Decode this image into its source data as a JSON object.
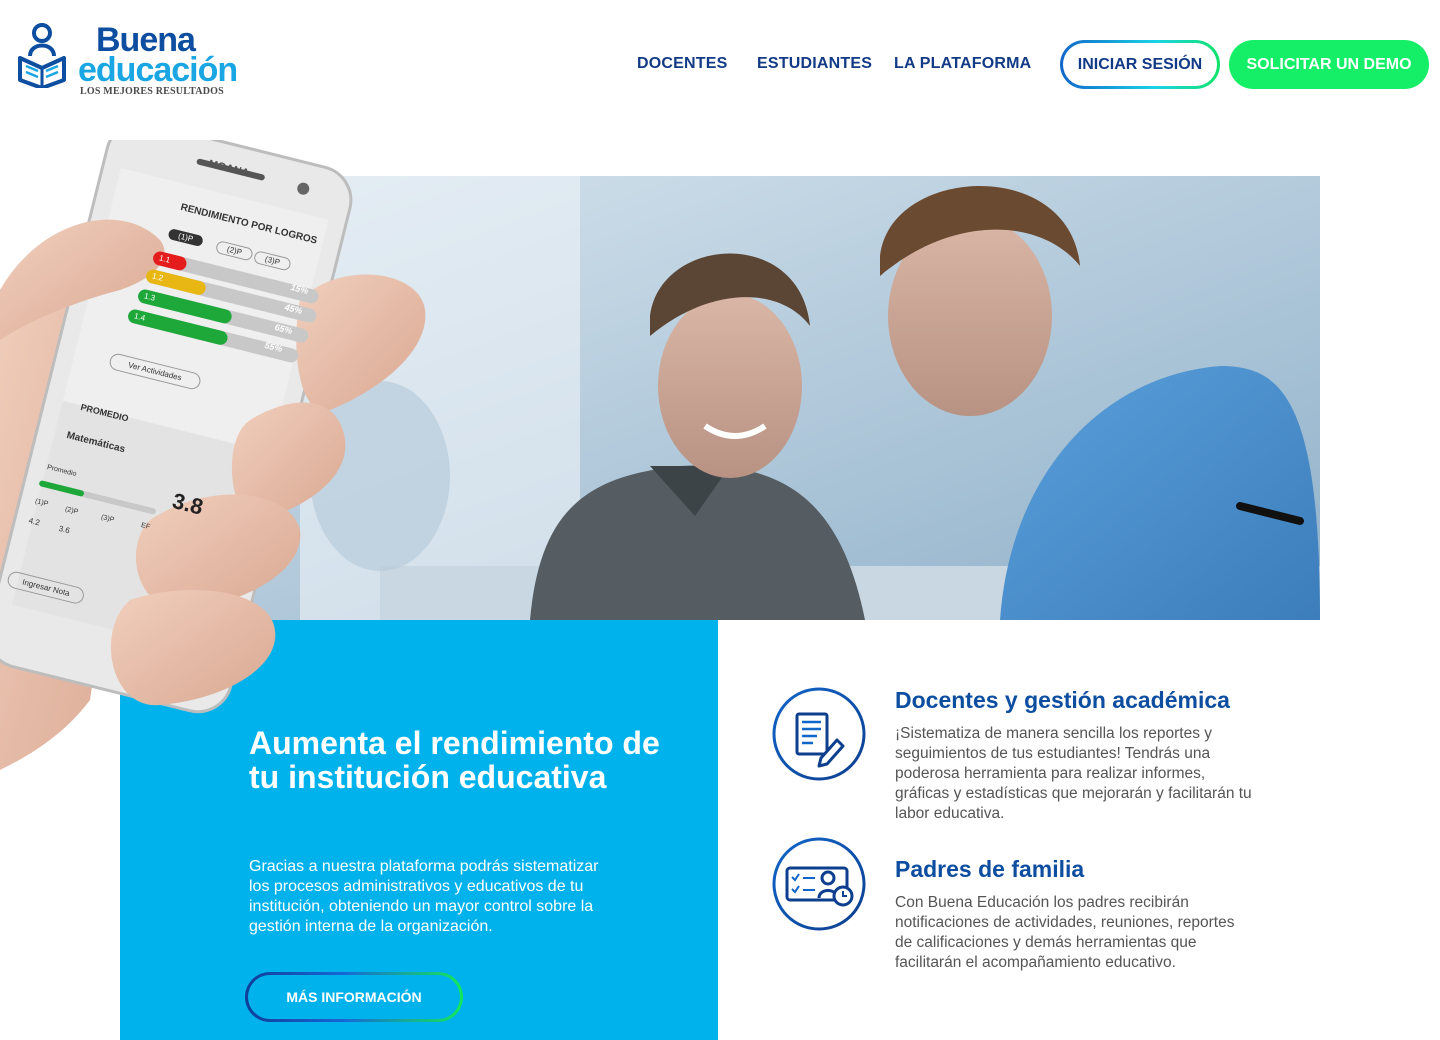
{
  "brand": {
    "name_line1": "Buena",
    "name_line2": "educación",
    "tagline": "LOS MEJORES RESULTADOS",
    "colors": {
      "dark_blue": "#0d4ea0",
      "light_blue": "#1aa6e3",
      "green": "#15ef67",
      "panel_blue": "#00b2ec"
    }
  },
  "nav": {
    "items": [
      "DOCENTES",
      "ESTUDIANTES",
      "LA PLATAFORMA"
    ],
    "login_label": "INICIAR SESIÓN",
    "demo_label": "SOLICITAR UN DEMO"
  },
  "phone": {
    "brand": "MOANA",
    "section_title": "RENDIMIENTO POR LOGROS",
    "period_tabs": [
      "(1)P",
      "(2)P",
      "(3)P"
    ],
    "achievements": [
      {
        "label": "1.1",
        "percent_label": "",
        "fill": 0.15,
        "color": "#e51c1c"
      },
      {
        "label": "1.2",
        "percent_label": "15%",
        "fill": 0.35,
        "color": "#e8b713"
      },
      {
        "label": "1.3",
        "percent_label": "45%",
        "fill": 0.55,
        "color": "#1fa83a"
      },
      {
        "label": "1.4",
        "percent_label": "65%",
        "fill": 0.55,
        "color": "#1fa83a"
      },
      {
        "label": "",
        "percent_label": "55%",
        "fill": 0,
        "color": "#1fa83a"
      }
    ],
    "activities_button": "Ver Actividades",
    "average_title": "PROMEDIO",
    "subject": "Matemáticas",
    "average_label": "Promedio",
    "average_value": "3.8",
    "periods": [
      {
        "name": "(1)P",
        "grade": "4.2"
      },
      {
        "name": "(2)P",
        "grade": "3.6"
      },
      {
        "name": "(3)P",
        "grade": ""
      },
      {
        "name": "EF",
        "grade": ""
      }
    ],
    "grade_button": "Ingresar Nota"
  },
  "hero": {
    "title": "Aumenta el rendimiento de tu institución educativa",
    "description": "Gracias a nuestra plataforma podrás sistematizar los procesos administrativos y educativos de tu institución, obteniendo un mayor control sobre la gestión interna de la organización.",
    "button_label": "MÁS INFORMACIÓN"
  },
  "features": [
    {
      "icon": "document-pencil-icon",
      "title": "Docentes y gestión académica",
      "text": "¡Sistematiza de manera sencilla los reportes y seguimientos de tus estudiantes! Tendrás una poderosa herramienta para  realizar informes, gráficas y estadísticas que mejorarán y facilitarán tu labor educativa."
    },
    {
      "icon": "checklist-parent-clock-icon",
      "title": "Padres de familia",
      "text": "Con Buena Educación los padres recibirán notificaciones de actividades, reuniones, reportes de calificaciones y demás herramientas que facilitarán el acompañamiento educativo."
    }
  ]
}
